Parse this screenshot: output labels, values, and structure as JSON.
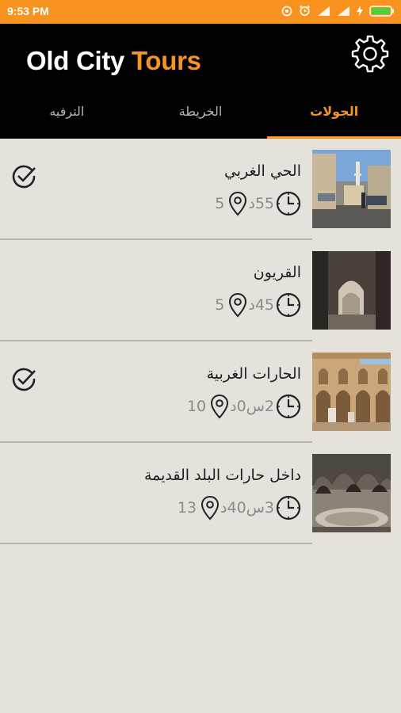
{
  "status": {
    "time": "9:53 PM"
  },
  "app": {
    "title_part1": "Old City",
    "title_part2": "Tours"
  },
  "tabs": [
    {
      "label": "الترفيه",
      "active": false
    },
    {
      "label": "الخريطة",
      "active": false
    },
    {
      "label": "الجولات",
      "active": true
    }
  ],
  "tours": [
    {
      "title": "الحي الغربي",
      "duration": "55د",
      "stops": "5",
      "completed": true
    },
    {
      "title": "القريون",
      "duration": "45د",
      "stops": "5",
      "completed": false
    },
    {
      "title": "الحارات الغربية",
      "duration": "2س0د",
      "stops": "10",
      "completed": true
    },
    {
      "title": "داخل حارات البلد القديمة",
      "duration": "3س40د",
      "stops": "13",
      "completed": false
    }
  ],
  "colors": {
    "accent": "#f7931e",
    "appbar": "#000000",
    "background": "#e5e2dc"
  }
}
